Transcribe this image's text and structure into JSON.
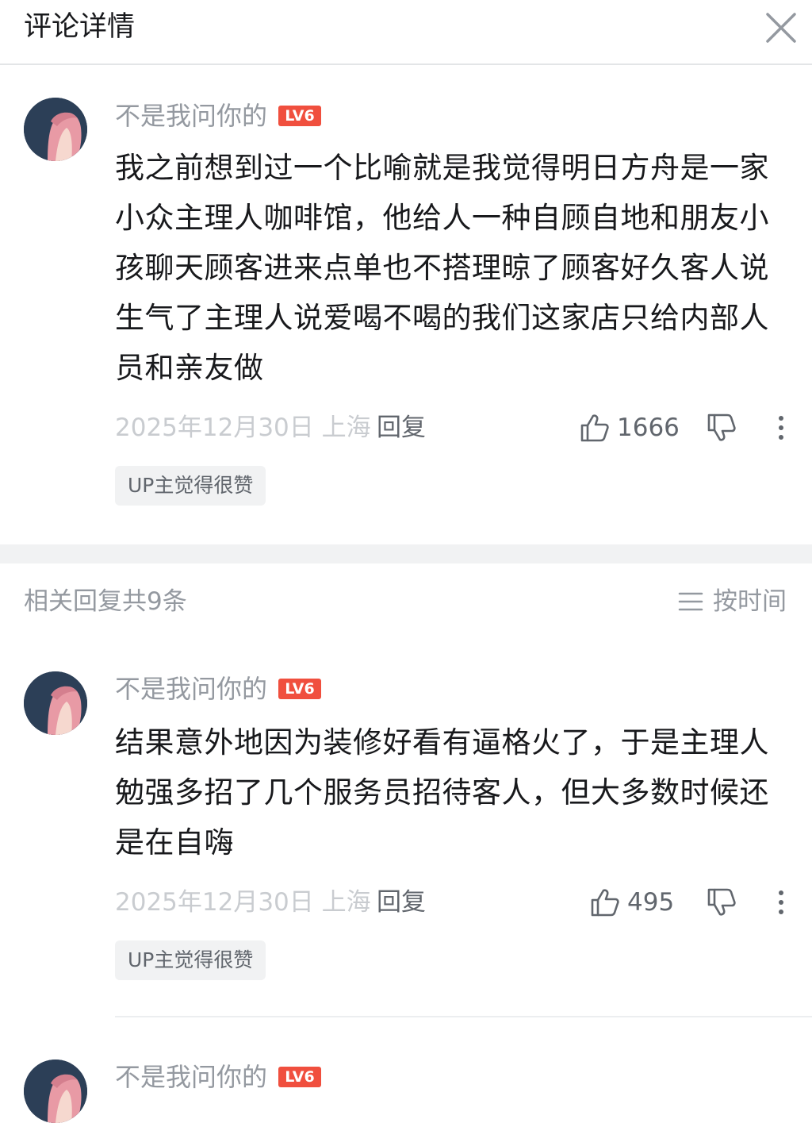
{
  "header": {
    "title": "评论详情",
    "close_icon": "close-icon"
  },
  "main_comment": {
    "username": "不是我问你的",
    "level": "LV6",
    "text": "我之前想到过一个比喻就是我觉得明日方舟是一家小众主理人咖啡馆，他给人一种自顾自地和朋友小孩聊天顾客进来点单也不搭理晾了顾客好久客人说生气了主理人说爱喝不喝的我们这家店只给内部人员和亲友做",
    "date_location": "2025年12月30日 上海",
    "reply_label": "回复",
    "like_count": "1666",
    "up_tag": "UP主觉得很赞"
  },
  "replies_section": {
    "count_label": "相关回复共9条",
    "sort_label": "按时间"
  },
  "replies": [
    {
      "username": "不是我问你的",
      "level": "LV6",
      "text": "结果意外地因为装修好看有逼格火了，于是主理人勉强多招了几个服务员招待客人，但大多数时候还是在自嗨",
      "date_location": "2025年12月30日 上海",
      "reply_label": "回复",
      "like_count": "495",
      "up_tag": "UP主觉得很赞"
    },
    {
      "username": "不是我问你的",
      "level": "LV6"
    }
  ],
  "colors": {
    "level_badge": "#f04f3e",
    "muted_text": "#9499a0",
    "light_text": "#c9ccd0",
    "body_text": "#18191c"
  }
}
